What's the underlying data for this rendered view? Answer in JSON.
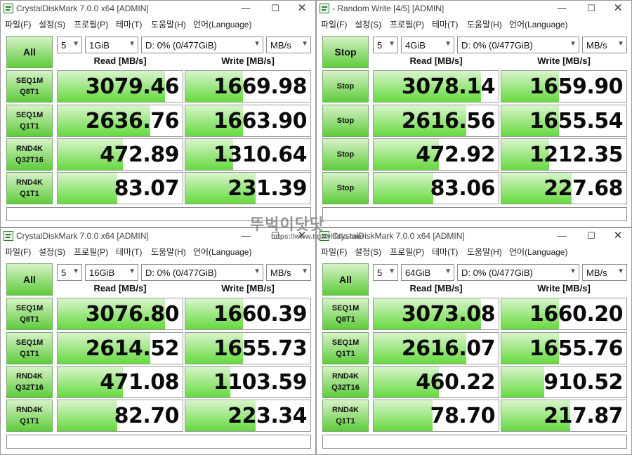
{
  "menu": [
    "파일(F)",
    "설정(S)",
    "프로필(P)",
    "테마(T)",
    "도움말(H)",
    "언어(Language)"
  ],
  "column_headers": {
    "read": "Read [MB/s]",
    "write": "Write [MB/s]"
  },
  "watermark": {
    "text": "뚜벅이닷닷",
    "url": "https://www.tlgawlddlo.com"
  },
  "windows": [
    {
      "title": "CrystalDiskMark 7.0.0 x64 [ADMIN]",
      "main_button": "All",
      "count": "5",
      "size": "1GiB",
      "drive": "D: 0% (0/477GiB)",
      "unit": "MB/s",
      "rows": [
        {
          "l1": "SEQ1M",
          "l2": "Q8T1",
          "read": "3079.46",
          "write": "1669.98",
          "read_fill": 0.86,
          "write_fill": 0.46
        },
        {
          "l1": "SEQ1M",
          "l2": "Q1T1",
          "read": "2636.76",
          "write": "1663.90",
          "read_fill": 0.74,
          "write_fill": 0.46
        },
        {
          "l1": "RND4K",
          "l2": "Q32T16",
          "read": "472.89",
          "write": "1310.64",
          "read_fill": 0.52,
          "write_fill": 0.38
        },
        {
          "l1": "RND4K",
          "l2": "Q1T1",
          "read": "83.07",
          "write": "231.39",
          "read_fill": 0.48,
          "write_fill": 0.56
        }
      ]
    },
    {
      "title": "- Random Write [4/5] [ADMIN]",
      "main_button": "Stop",
      "count": "5",
      "size": "4GiB",
      "drive": "D: 0% (0/477GiB)",
      "unit": "MB/s",
      "rows": [
        {
          "l1": "Stop",
          "l2": "",
          "read": "3078.14",
          "write": "1659.90",
          "read_fill": 0.86,
          "write_fill": 0.46
        },
        {
          "l1": "Stop",
          "l2": "",
          "read": "2616.56",
          "write": "1655.54",
          "read_fill": 0.74,
          "write_fill": 0.46
        },
        {
          "l1": "Stop",
          "l2": "",
          "read": "472.92",
          "write": "1212.35",
          "read_fill": 0.52,
          "write_fill": 0.38
        },
        {
          "l1": "Stop",
          "l2": "",
          "read": "83.06",
          "write": "227.68",
          "read_fill": 0.48,
          "write_fill": 0.56
        }
      ]
    },
    {
      "title": "CrystalDiskMark 7.0.0 x64 [ADMIN]",
      "main_button": "All",
      "count": "5",
      "size": "16GiB",
      "drive": "D: 0% (0/477GiB)",
      "unit": "MB/s",
      "rows": [
        {
          "l1": "SEQ1M",
          "l2": "Q8T1",
          "read": "3076.80",
          "write": "1660.39",
          "read_fill": 0.86,
          "write_fill": 0.46
        },
        {
          "l1": "SEQ1M",
          "l2": "Q1T1",
          "read": "2614.52",
          "write": "1655.73",
          "read_fill": 0.74,
          "write_fill": 0.46
        },
        {
          "l1": "RND4K",
          "l2": "Q32T16",
          "read": "471.08",
          "write": "1103.59",
          "read_fill": 0.52,
          "write_fill": 0.36
        },
        {
          "l1": "RND4K",
          "l2": "Q1T1",
          "read": "82.70",
          "write": "223.34",
          "read_fill": 0.48,
          "write_fill": 0.56
        }
      ]
    },
    {
      "title": "CrystalDiskMark 7.0.0 x64 [ADMIN]",
      "main_button": "All",
      "count": "5",
      "size": "64GiB",
      "drive": "D: 0% (0/477GiB)",
      "unit": "MB/s",
      "rows": [
        {
          "l1": "SEQ1M",
          "l2": "Q8T1",
          "read": "3073.08",
          "write": "1660.20",
          "read_fill": 0.86,
          "write_fill": 0.46
        },
        {
          "l1": "SEQ1M",
          "l2": "Q1T1",
          "read": "2616.07",
          "write": "1655.76",
          "read_fill": 0.74,
          "write_fill": 0.46
        },
        {
          "l1": "RND4K",
          "l2": "Q32T16",
          "read": "460.22",
          "write": "910.52",
          "read_fill": 0.52,
          "write_fill": 0.34
        },
        {
          "l1": "RND4K",
          "l2": "Q1T1",
          "read": "78.70",
          "write": "217.87",
          "read_fill": 0.47,
          "write_fill": 0.55
        }
      ]
    }
  ]
}
